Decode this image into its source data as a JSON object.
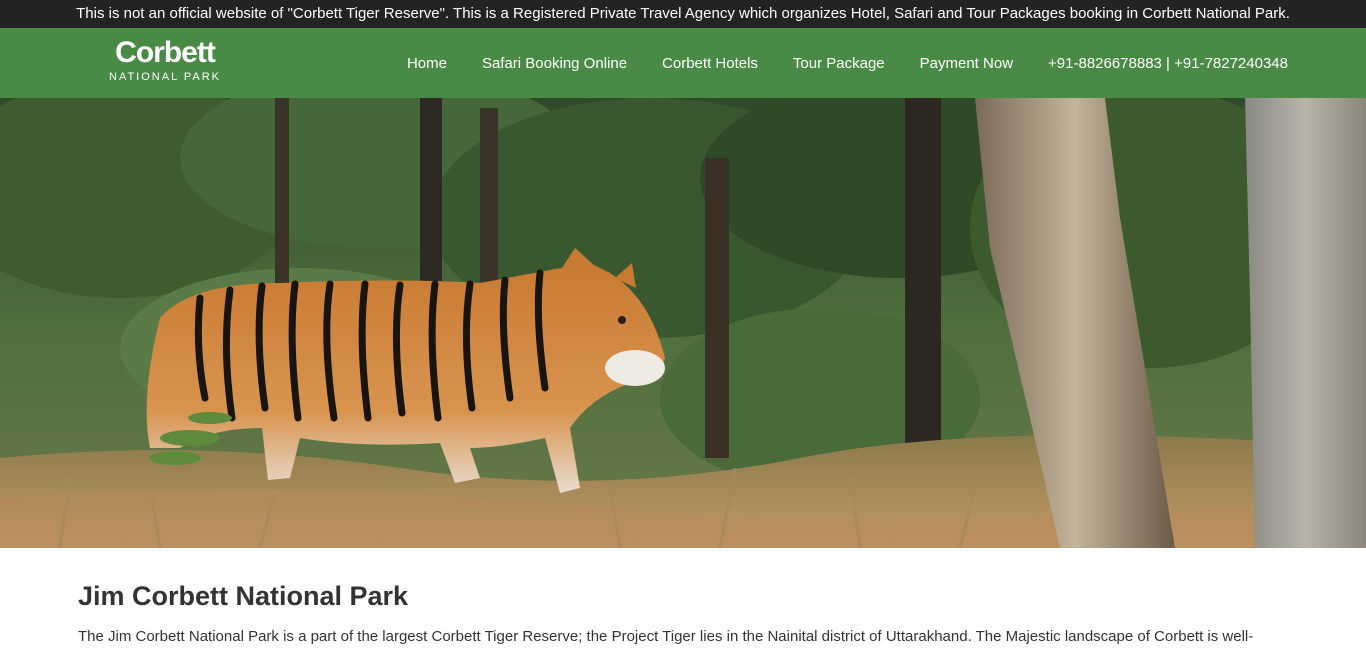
{
  "topbar": {
    "notice": "This is not an official website of \"Corbett Tiger Reserve\". This is a Registered Private Travel Agency which organizes Hotel, Safari and Tour Packages booking in Corbett National Park."
  },
  "logo": {
    "name": "Corbett",
    "subtitle": "NATIONAL PARK"
  },
  "nav": {
    "items": [
      {
        "label": "Home"
      },
      {
        "label": "Safari Booking Online"
      },
      {
        "label": "Corbett Hotels"
      },
      {
        "label": "Tour Package"
      },
      {
        "label": "Payment Now"
      },
      {
        "label": "+91-8826678883 | +91-7827240348"
      }
    ]
  },
  "hero": {
    "image": "tiger-in-forest-photo"
  },
  "main": {
    "title": "Jim Corbett National Park",
    "intro": "The Jim Corbett National Park is a part of the largest Corbett Tiger Reserve; the Project Tiger lies in the Nainital district of Uttarakhand. The Majestic landscape of Corbett is well-"
  },
  "colors": {
    "topbar_bg": "#232323",
    "nav_bg": "#4a8a47",
    "text": "#333333"
  }
}
